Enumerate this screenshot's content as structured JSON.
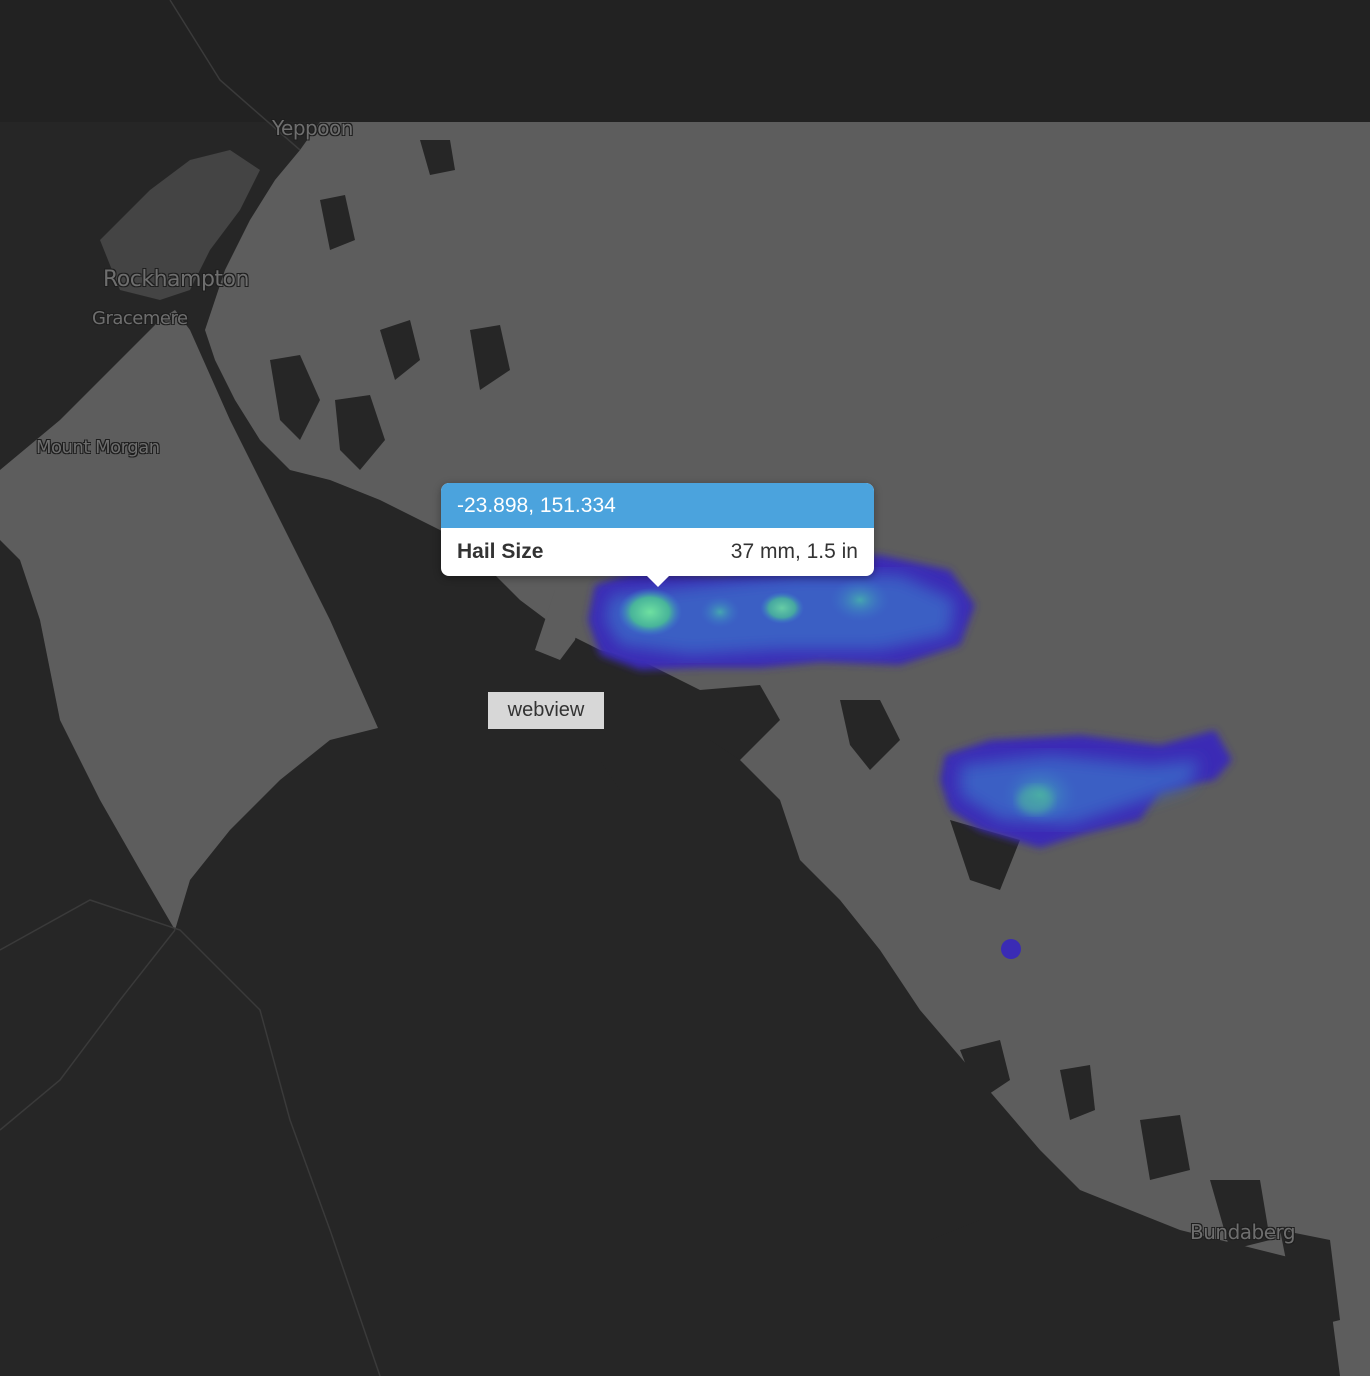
{
  "map": {
    "place_labels": [
      {
        "id": "yeppoon",
        "text": "Yeppoon"
      },
      {
        "id": "rockhampton",
        "text": "Rockhampton"
      },
      {
        "id": "gracemere",
        "text": "Gracemere"
      },
      {
        "id": "mount-morgan",
        "text": "Mount Morgan"
      },
      {
        "id": "bundaberg",
        "text": "Bundaberg"
      }
    ],
    "colors": {
      "land": "#262626",
      "highlighted_region": "#5d5d5d",
      "heat_low": "#3a2bb5",
      "heat_mid": "#3f7fd0",
      "heat_high": "#5ccf9a"
    }
  },
  "popup": {
    "coordinates": "-23.898, 151.334",
    "field_label": "Hail Size",
    "field_value": "37 mm, 1.5 in",
    "header_color": "#4ba3dd"
  },
  "badge": {
    "label": "webview"
  }
}
